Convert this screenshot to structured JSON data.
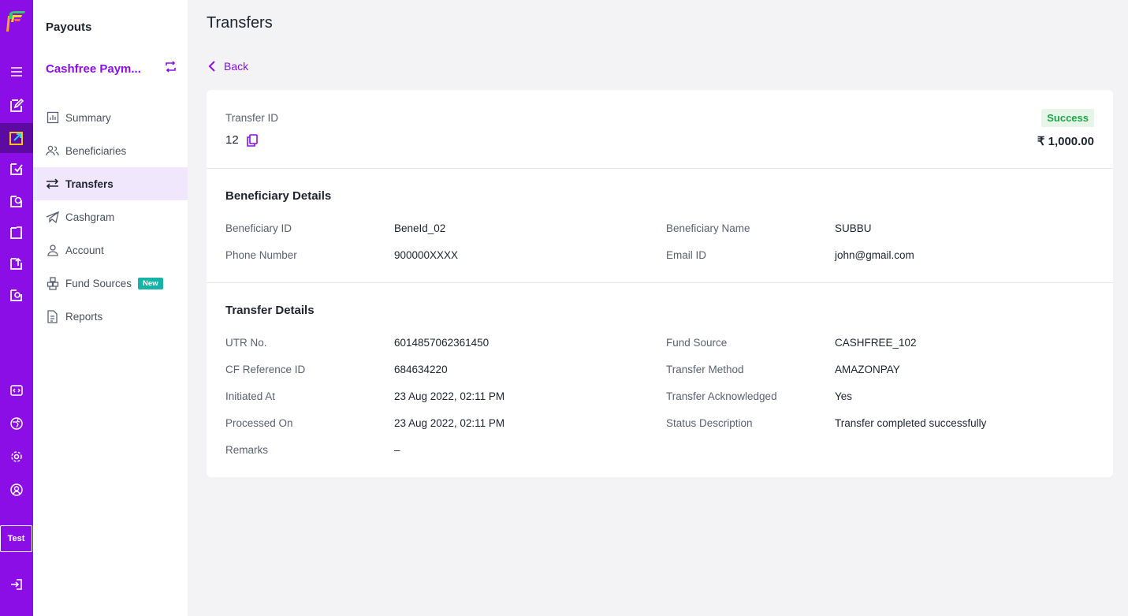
{
  "app": {
    "title": "Payouts"
  },
  "account": {
    "name": "Cashfree Paym..."
  },
  "rail": {
    "environment_label": "Test",
    "icons": [
      "menu-icon",
      "edit-document-icon",
      "payouts-icon",
      "check-document-icon",
      "refresh-document-icon",
      "document-icon",
      "document-upload-icon",
      "document-circle-icon",
      "developer-icon",
      "globe-icon",
      "settings-icon",
      "profile-icon",
      "logout-icon"
    ]
  },
  "nav": {
    "items": [
      {
        "label": "Summary",
        "icon": "bar-chart-icon"
      },
      {
        "label": "Beneficiaries",
        "icon": "users-icon"
      },
      {
        "label": "Transfers",
        "icon": "transfer-arrows-icon",
        "active": true
      },
      {
        "label": "Cashgram",
        "icon": "paper-plane-icon"
      },
      {
        "label": "Account",
        "icon": "person-icon"
      },
      {
        "label": "Fund Sources",
        "icon": "boxes-icon",
        "badge": "New"
      },
      {
        "label": "Reports",
        "icon": "file-icon"
      }
    ]
  },
  "page": {
    "title": "Transfers",
    "back_label": "Back"
  },
  "transfer": {
    "id_label": "Transfer ID",
    "id_value": "12",
    "status": "Success",
    "amount": "₹ 1,000.00"
  },
  "beneficiary": {
    "title": "Beneficiary Details",
    "rows": [
      {
        "l1": "Beneficiary ID",
        "v1": "BeneId_02",
        "l2": "Beneficiary Name",
        "v2": "SUBBU"
      },
      {
        "l1": "Phone Number",
        "v1": "900000XXXX",
        "l2": "Email ID",
        "v2": "john@gmail.com"
      }
    ]
  },
  "details": {
    "title": "Transfer Details",
    "rows": [
      {
        "l1": "UTR No.",
        "v1": "6014857062361450",
        "l2": "Fund Source",
        "v2": "CASHFREE_102"
      },
      {
        "l1": "CF Reference ID",
        "v1": "684634220",
        "l2": "Transfer Method",
        "v2": "AMAZONPAY"
      },
      {
        "l1": "Initiated At",
        "v1": "23 Aug 2022, 02:11 PM",
        "l2": "Transfer Acknowledged",
        "v2": "Yes"
      },
      {
        "l1": "Processed On",
        "v1": "23 Aug 2022, 02:11 PM",
        "l2": "Status Description",
        "v2": "Transfer completed successfully"
      },
      {
        "l1": "Remarks",
        "v1": "–"
      }
    ]
  },
  "colors": {
    "brand": "#8a0ee5",
    "rail_active": "#5d0aa3",
    "success_text": "#1ea34a",
    "success_bg": "#e5f6e9",
    "badge_new": "#16b3a6"
  }
}
